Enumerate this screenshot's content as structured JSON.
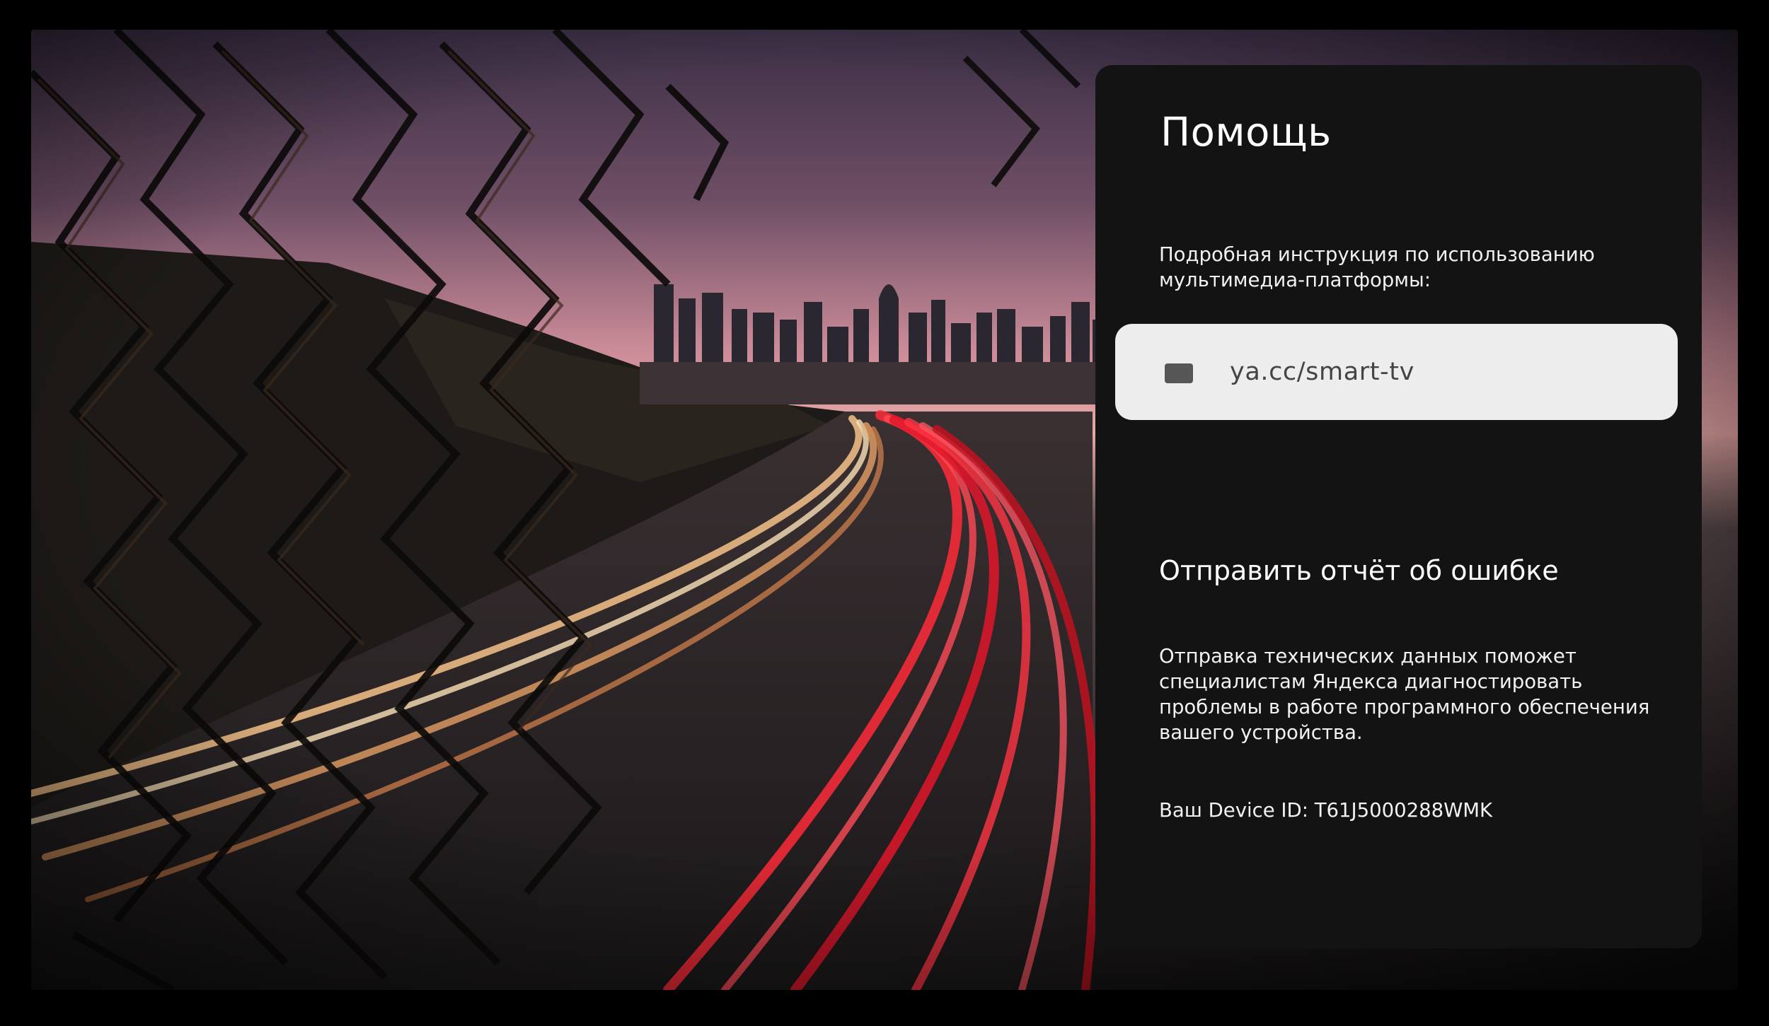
{
  "help_panel": {
    "title": "Помощь",
    "instruction_text": "Подробная инструкция по использованию мультимедиа-платформы:",
    "link": {
      "icon": "screen-icon",
      "label": "ya.cc/smart-tv"
    },
    "report": {
      "heading": "Отправить отчёт об ошибке",
      "description": "Отправка технических данных поможет специалистам Яндекса диагностировать проблемы в работе программного обеспечения вашего устройства.",
      "device_id": "Ваш Device ID: T61J5000288WMK"
    }
  },
  "colors": {
    "panel_background": "#131314",
    "link_button_background": "#ededed",
    "link_text": "#444444",
    "text_primary": "#ffffff"
  }
}
